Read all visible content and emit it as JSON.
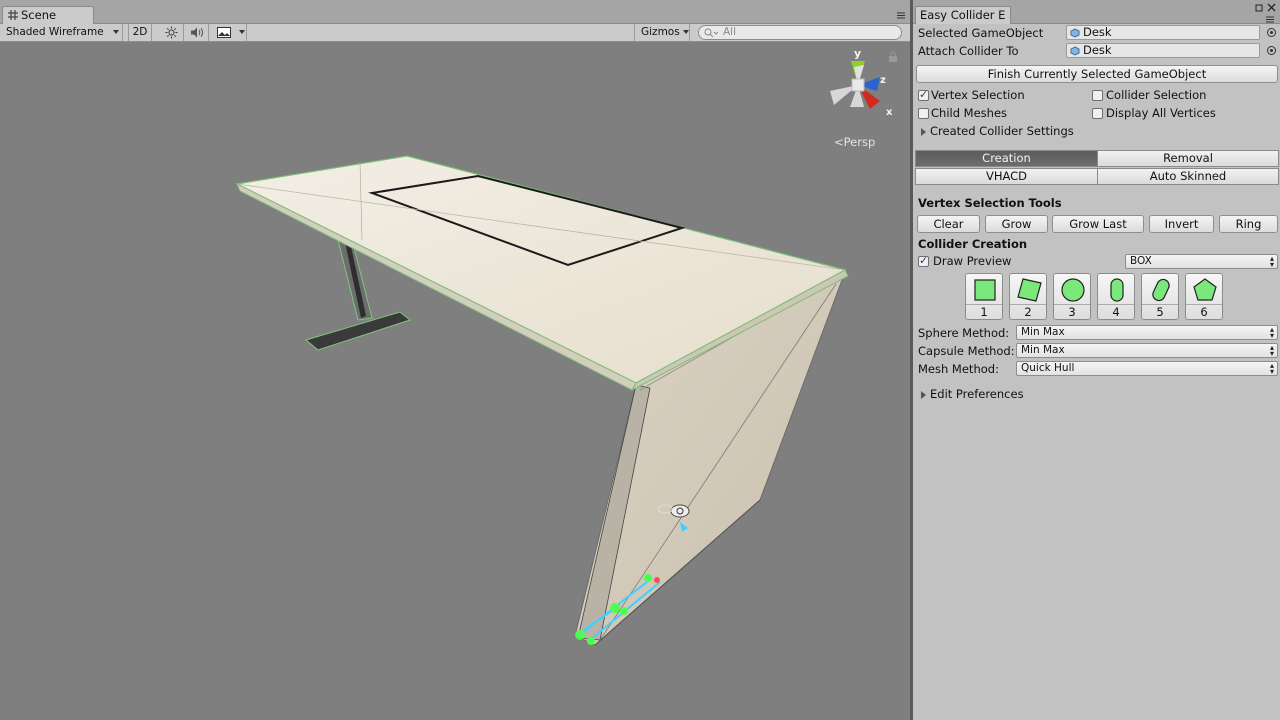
{
  "scene": {
    "tab_label": "Scene",
    "toolbar": {
      "shading_mode": "Shaded Wireframe",
      "btn_2d": "2D",
      "gizmos_label": "Gizmos",
      "search_placeholder": "All"
    },
    "gizmo": {
      "x_label": "x",
      "y_label": "y",
      "z_label": "z"
    },
    "projection_label": "Persp"
  },
  "panel": {
    "tab_label": "Easy Collider E",
    "selected_gameobject_label": "Selected GameObject",
    "selected_gameobject_value": "Desk",
    "attach_collider_label": "Attach Collider To",
    "attach_collider_value": "Desk",
    "finish_button": "Finish Currently Selected GameObject",
    "toggles": {
      "vertex_selection": {
        "label": "Vertex Selection",
        "checked": true
      },
      "collider_selection": {
        "label": "Collider Selection",
        "checked": false
      },
      "child_meshes": {
        "label": "Child Meshes",
        "checked": false
      },
      "display_all_vertices": {
        "label": "Display All Vertices",
        "checked": false
      }
    },
    "created_collider_settings": "Created Collider Settings",
    "mode_tabs": [
      "Creation",
      "Removal",
      "VHACD",
      "Auto Skinned"
    ],
    "active_mode": "Creation",
    "vertex_tools_header": "Vertex Selection Tools",
    "vertex_tools": [
      "Clear",
      "Grow",
      "Grow Last",
      "Invert",
      "Ring"
    ],
    "collider_creation_header": "Collider Creation",
    "draw_preview": {
      "label": "Draw Preview",
      "checked": true,
      "value": "BOX"
    },
    "shape_buttons": [
      {
        "number": "1",
        "icon": "box-collider-icon"
      },
      {
        "number": "2",
        "icon": "rotated-box-collider-icon"
      },
      {
        "number": "3",
        "icon": "sphere-collider-icon"
      },
      {
        "number": "4",
        "icon": "capsule-collider-icon"
      },
      {
        "number": "5",
        "icon": "rotated-capsule-collider-icon"
      },
      {
        "number": "6",
        "icon": "convex-mesh-collider-icon"
      }
    ],
    "sphere_method": {
      "label": "Sphere Method:",
      "value": "Min Max"
    },
    "capsule_method": {
      "label": "Capsule Method:",
      "value": "Min Max"
    },
    "mesh_method": {
      "label": "Mesh Method:",
      "value": "Quick Hull"
    },
    "edit_preferences": "Edit Preferences"
  },
  "colors": {
    "viewport_bg": "#7f7f7f",
    "panel_bg": "#c2c2c2",
    "active_tab": "#5c5c5c",
    "collider_green": "#6fe46f",
    "axis_x": "#d12a1f",
    "axis_y": "#8ed12a",
    "axis_z": "#2a64d1"
  }
}
